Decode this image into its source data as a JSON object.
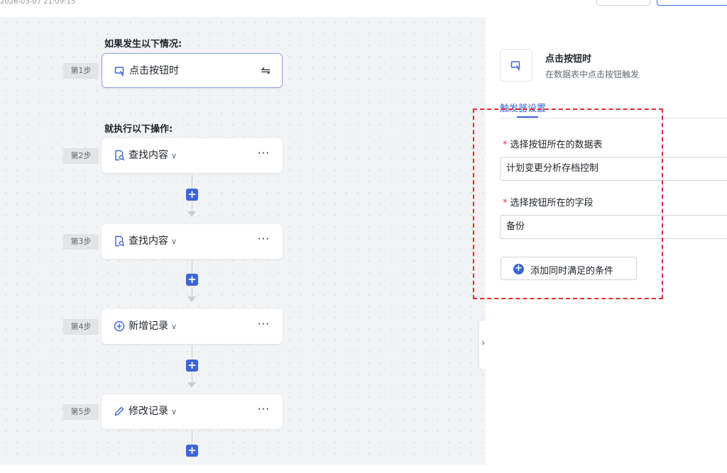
{
  "header": {
    "timestamp": "2026-03-07 21:09:15"
  },
  "flow": {
    "trigger_heading": "如果发生以下情况:",
    "action_heading": "就执行以下操作:",
    "trigger": {
      "step": "第1步",
      "label": "点击按钮时",
      "icon": "cursor-click-icon"
    },
    "steps": [
      {
        "step": "第2步",
        "label": "查找内容",
        "icon": "search-doc-icon"
      },
      {
        "step": "第3步",
        "label": "查找内容",
        "icon": "search-doc-icon"
      },
      {
        "step": "第4步",
        "label": "新增记录",
        "icon": "add-circle-icon"
      },
      {
        "step": "第5步",
        "label": "修改记录",
        "icon": "pencil-icon"
      }
    ]
  },
  "panel": {
    "title": "点击按钮时",
    "subtitle": "在数据表中点击按钮触发",
    "tab": "触发器设置",
    "fields": [
      {
        "label": "选择按钮所在的数据表",
        "value": "计划变更分析存档控制"
      },
      {
        "label": "选择按钮所在的字段",
        "value": "备份"
      }
    ],
    "add_condition": "添加同时满足的条件"
  },
  "accent": "#3b64d9",
  "highlight": "#e02b2b"
}
